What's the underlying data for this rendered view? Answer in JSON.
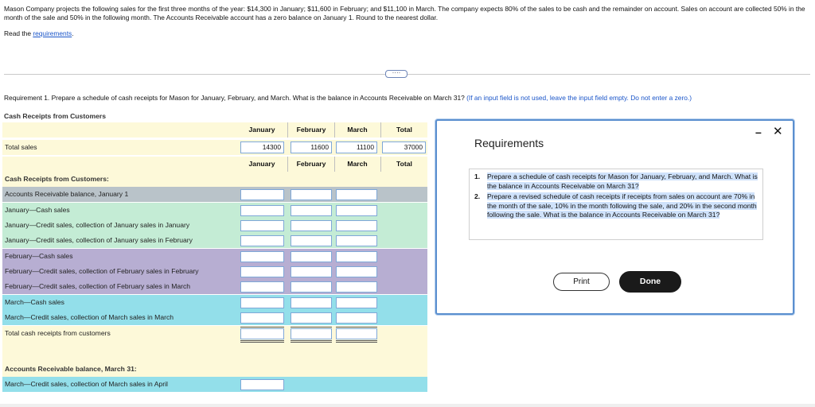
{
  "problem": {
    "text": "Mason Company projects the following sales for the first three months of the year: $14,300 in January; $11,600 in February; and $11,100 in March. The company expects 80% of the sales to be cash and the remainder on account. Sales on account are collected 50% in the month of the sale and 50% in the following month. The Accounts Receivable account has a zero balance on January 1. Round to the nearest dollar.",
    "read_prefix": "Read the ",
    "read_link": "requirements",
    "read_suffix": "."
  },
  "expander_label": "····",
  "requirement1": {
    "text": "Requirement 1. Prepare a schedule of cash receipts for Mason for January, February, and March. What is the balance in Accounts Receivable on March 31? ",
    "hint": "(If an input field is not used, leave the input field empty. Do not enter a zero.)"
  },
  "table": {
    "title": "Cash Receipts from Customers",
    "columns": [
      "January",
      "February",
      "March",
      "Total"
    ],
    "total_sales_label": "Total sales",
    "total_sales_values": [
      "14300",
      "11600",
      "11100",
      "37000"
    ],
    "section_label": "Cash Receipts from Customers:",
    "rows": [
      "Accounts Receivable balance, January 1",
      "January—Cash sales",
      "January—Credit sales, collection of January sales in January",
      "January—Credit sales, collection of January sales in February",
      "February—Cash sales",
      "February—Credit sales, collection of February sales in February",
      "February—Credit sales, collection of February sales in March",
      "March—Cash sales",
      "March—Credit sales, collection of March sales in March"
    ],
    "total_label": "Total cash receipts from customers",
    "ar_label": "Accounts Receivable balance, March 31:",
    "ar_row": "March—Credit sales, collection of March sales in April"
  },
  "modal": {
    "title": "Requirements",
    "minimize": "–",
    "close": "✕",
    "items": [
      {
        "num": "1.",
        "text": "Prepare a schedule of cash receipts for Mason for January, February, and March. What is the balance in Accounts Receivable on March 31?"
      },
      {
        "num": "2.",
        "text": "Prepare a revised schedule of cash receipts if receipts from sales on account are 70% in the month of the sale, 10% in the month following the sale, and 20% in the second month following the sale. What is the balance in Accounts Receivable on March 31?"
      }
    ],
    "print_label": "Print",
    "done_label": "Done"
  },
  "colors": {
    "header_bg": "#fdf9d9",
    "grey": "#b9c3c9",
    "green": "#c4ecd5",
    "purple": "#b7aed2",
    "cyan": "#93dfea",
    "field_border": "#7fa8d8",
    "modal_border": "#5b8fcf"
  }
}
